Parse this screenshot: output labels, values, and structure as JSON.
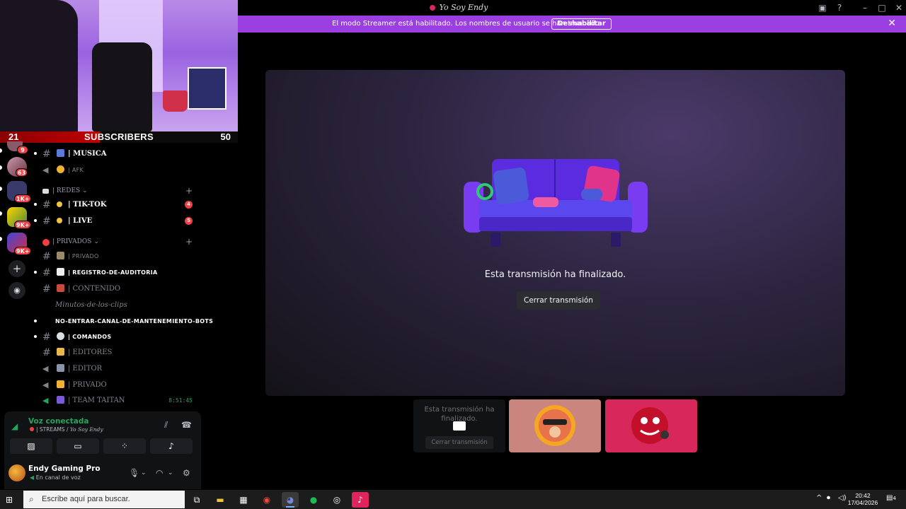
{
  "webcam": {
    "subs_left": "21",
    "subs_label": "SUBSCRIBERS",
    "subs_right": "50",
    "subs_progress": 0.42
  },
  "titlebar": {
    "title": "Yo Soy Endy"
  },
  "banner": {
    "message": "El modo Streamer está habilitado. Los nombres de usuario se han truncado.",
    "button": "Deshabilitar"
  },
  "servers": {
    "badges": [
      "9",
      "63",
      "1K+",
      "9K+",
      "9K+"
    ]
  },
  "channels": {
    "items": [
      {
        "name": "| MUSICA",
        "style": "bright"
      },
      {
        "name": "| AFK",
        "style": "small"
      },
      {
        "category": "| REDES",
        "chevron": "⌄"
      },
      {
        "name": "| TIK-TOK",
        "style": "bright",
        "badge": "4"
      },
      {
        "name": "| LIVE",
        "style": "bright",
        "badge": "5"
      },
      {
        "category": "| PRIVADOS",
        "chevron": "⌄"
      },
      {
        "name": "| PRIVADO",
        "style": "small"
      },
      {
        "name": "| REGISTRO-DE-AUDITORIA",
        "style": "small-bright"
      },
      {
        "name": "| CONTENIDO",
        "style": "dim"
      },
      {
        "name": "Minutos-de-los-clips",
        "style": "italic"
      },
      {
        "name": "NO-ENTRAR-CANAL-DE-MANTENEMIENTO-BOTS",
        "style": "small-bright"
      },
      {
        "name": "| COMANDOS",
        "style": "small-bright"
      },
      {
        "name": "| EDITORES",
        "style": "dim"
      },
      {
        "name": "| EDITOR",
        "style": "dim"
      },
      {
        "name": "| PRIVADO",
        "style": "dim"
      },
      {
        "name": "| TEAM TAITAN",
        "style": "dim",
        "time": "8:51:45"
      }
    ]
  },
  "voice": {
    "status": "Voz conectada",
    "location_prefix": "| STREAMS /",
    "location_server": "Yo Soy Endy"
  },
  "user": {
    "name": "Endy Gaming Pro",
    "status": "En canal de voz"
  },
  "stage": {
    "message": "Esta transmisión ha finalizado.",
    "close_button": "Cerrar transmisión"
  },
  "tiles": {
    "ended_message": "Esta transmisión ha finalizado.",
    "ended_button": "Cerrar transmisión"
  },
  "taskbar": {
    "search_placeholder": "Escribe aquí para buscar.",
    "time": "20:42",
    "date": "17/04/2026",
    "notifications": "4"
  },
  "colors": {
    "banner": "#9b3fe3",
    "accent_green": "#23a55a",
    "badge_red": "#f23f43"
  }
}
